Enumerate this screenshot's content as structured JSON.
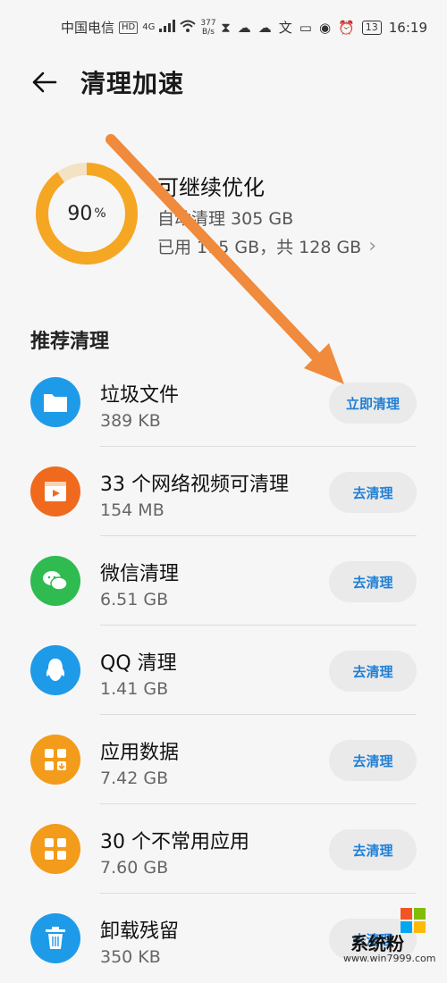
{
  "status_bar": {
    "carrier": "中国电信",
    "hd_badge": "HD",
    "network": "4G",
    "speed_value": "377",
    "speed_unit": "B/s",
    "battery": "13",
    "time": "16:19"
  },
  "header": {
    "title": "清理加速"
  },
  "summary": {
    "percent": "90",
    "percent_sign": "%",
    "percent_value": 90,
    "title": "可继续优化",
    "auto_clean": "自动清理 305 GB",
    "usage": "已用 115 GB，共 128 GB",
    "ring_color": "#f5a623"
  },
  "section_title": "推荐清理",
  "items": [
    {
      "name": "垃圾文件",
      "size": "389 KB",
      "button": "立即清理",
      "icon": "folder-icon",
      "color": "#1e9be8"
    },
    {
      "name": "33 个网络视频可清理",
      "size": "154 MB",
      "button": "去清理",
      "icon": "video-icon",
      "color": "#f06a1d"
    },
    {
      "name": "微信清理",
      "size": "6.51 GB",
      "button": "去清理",
      "icon": "wechat-icon",
      "color": "#2fbb4f"
    },
    {
      "name": "QQ 清理",
      "size": "1.41 GB",
      "button": "去清理",
      "icon": "qq-icon",
      "color": "#1e9be8"
    },
    {
      "name": "应用数据",
      "size": "7.42 GB",
      "button": "去清理",
      "icon": "app-data-icon",
      "color": "#f39b1a"
    },
    {
      "name": "30 个不常用应用",
      "size": "7.60 GB",
      "button": "去清理",
      "icon": "apps-grid-icon",
      "color": "#f39b1a"
    },
    {
      "name": "卸载残留",
      "size": "350 KB",
      "button": "去清理",
      "icon": "trash-icon",
      "color": "#1e9be8"
    }
  ],
  "watermark": {
    "text": "系统粉",
    "url": "www.win7999.com"
  },
  "accent": "#1f7fd6",
  "annotation_arrow_color": "#f08a3c"
}
